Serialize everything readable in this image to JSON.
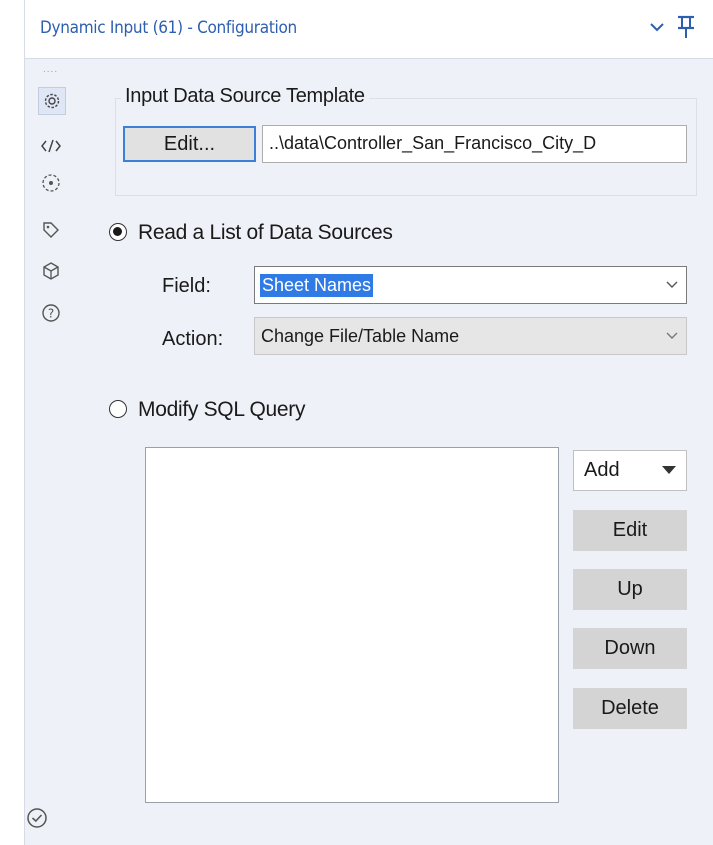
{
  "panel": {
    "title": "Dynamic Input (61) - Configuration"
  },
  "sidebar": {
    "items": [
      {
        "icon": "gear-icon",
        "active": true
      },
      {
        "icon": "code-icon",
        "active": false
      },
      {
        "icon": "connection-icon",
        "active": false
      },
      {
        "icon": "tag-icon",
        "active": false
      },
      {
        "icon": "cube-icon",
        "active": false
      },
      {
        "icon": "help-icon",
        "active": false
      }
    ]
  },
  "template": {
    "legend": "Input Data Source Template",
    "edit_label": "Edit...",
    "path": "..\\data\\Controller_San_Francisco_City_D"
  },
  "mode": {
    "option_list": "Read a List of Data Sources",
    "option_sql": "Modify SQL Query",
    "selected": "list"
  },
  "form": {
    "field_label": "Field:",
    "field_value": "Sheet Names",
    "action_label": "Action:",
    "action_value": "Change File/Table Name"
  },
  "sql_buttons": {
    "add": "Add",
    "edit": "Edit",
    "up": "Up",
    "down": "Down",
    "delete": "Delete"
  },
  "colors": {
    "title": "#2d5fb0",
    "selection": "#2f7ae5",
    "panel_bg": "#eef1f7"
  }
}
